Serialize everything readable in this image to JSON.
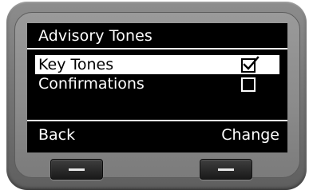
{
  "screen": {
    "title": "Advisory Tones",
    "options": [
      {
        "label": "Key Tones",
        "checked": true,
        "selected": true
      },
      {
        "label": "Confirmations",
        "checked": false,
        "selected": false
      }
    ],
    "softkeys": {
      "left": "Back",
      "right": "Change"
    }
  },
  "icons": {
    "checked": "checkbox-checked-icon",
    "unchecked": "checkbox-unchecked-icon",
    "softkey_bar": "minus-bar-icon"
  },
  "colors": {
    "screen_background": "#000000",
    "screen_text": "#ffffff",
    "highlight_background": "#ffffff",
    "highlight_text": "#000000",
    "device_body": "#808080",
    "hardware_button": "#1f1f1f"
  }
}
